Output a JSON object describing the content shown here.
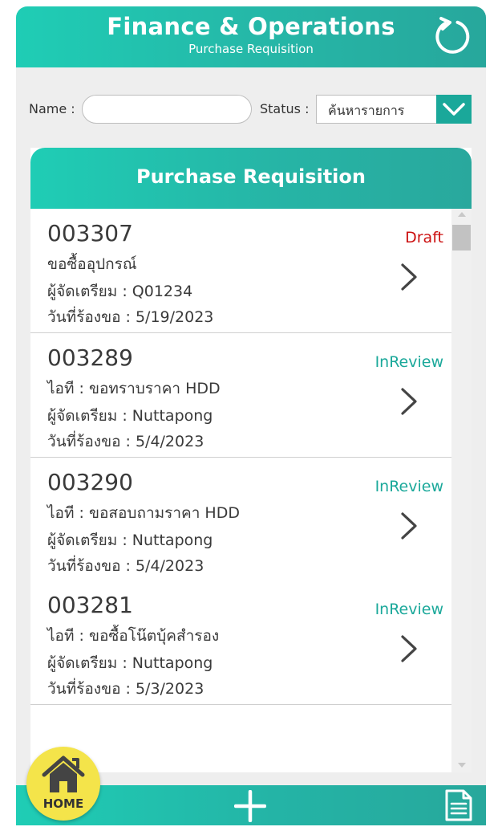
{
  "header": {
    "title": "Finance & Operations",
    "subtitle": "Purchase Requisition"
  },
  "filters": {
    "name_label": "Name :",
    "name_value": "",
    "status_label": "Status :",
    "status_value": "ค้นหารายการ"
  },
  "panel": {
    "title": "Purchase Requisition"
  },
  "items": [
    {
      "id": "003307",
      "description": "ขอซื้ออุปกรณ์",
      "preparer": "ผู้จัดเตรียม : Q01234",
      "date": "วันที่ร้องขอ : 5/19/2023",
      "status": "Draft"
    },
    {
      "id": "003289",
      "description": "ไอที : ขอทราบราคา HDD",
      "preparer": "ผู้จัดเตรียม : Nuttapong",
      "date": "วันที่ร้องขอ : 5/4/2023",
      "status": "InReview"
    },
    {
      "id": "003290",
      "description": "ไอที : ขอสอบถามราคา HDD",
      "preparer": "ผู้จัดเตรียม : Nuttapong",
      "date": "วันที่ร้องขอ : 5/4/2023",
      "status": "InReview"
    },
    {
      "id": "003281",
      "description": "ไอที : ขอซื้อโน๊ตบุ้คสำรอง",
      "preparer": "ผู้จัดเตรียม : Nuttapong",
      "date": "วันที่ร้องขอ : 5/3/2023",
      "status": "InReview"
    }
  ],
  "bottom_nav": {
    "home_label": "HOME"
  },
  "icons": {
    "refresh": "refresh-icon",
    "dropdown": "chevron-down-icon",
    "item_arrow": "chevron-right-icon",
    "home": "home-icon",
    "add": "plus-icon",
    "document": "document-icon"
  },
  "colors": {
    "primary": "#1fcdb5",
    "primary_dark": "#1aa89a",
    "draft": "#cc1111",
    "in_review": "#1aa89a",
    "home_button": "#f4e44a"
  }
}
